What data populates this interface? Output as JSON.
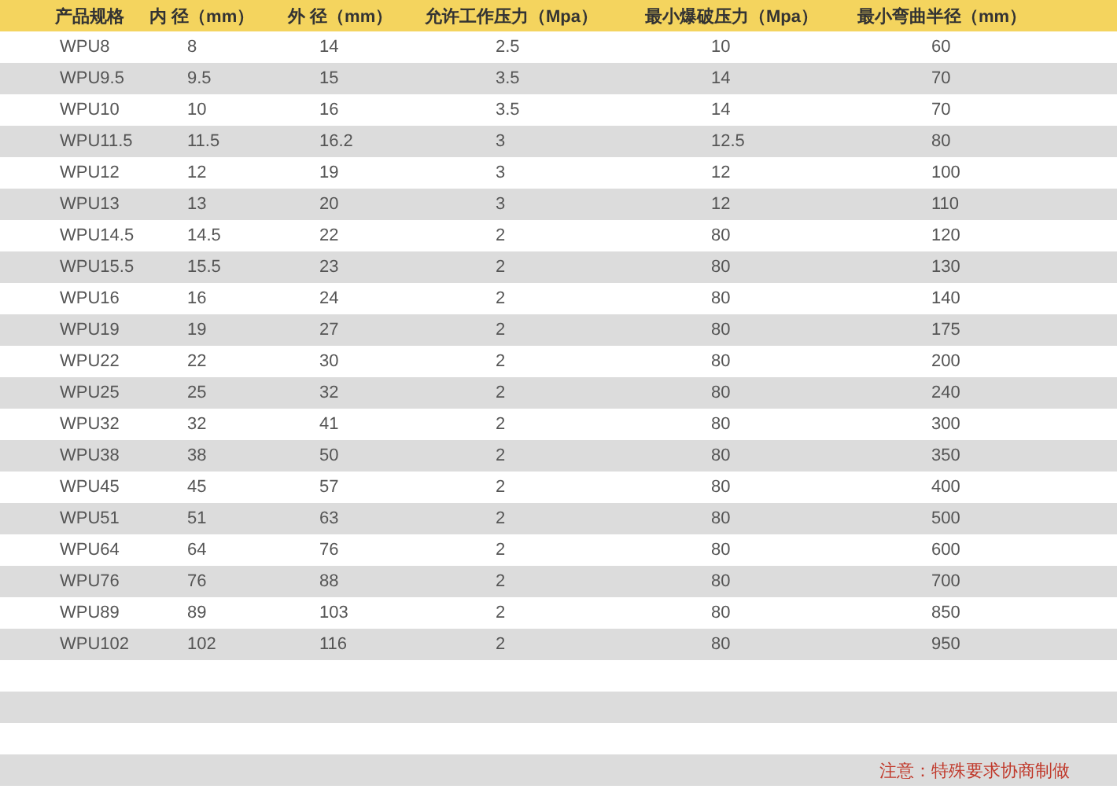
{
  "table": {
    "columns": [
      "产品规格",
      "内 径（mm）",
      "外 径（mm）",
      "允许工作压力（Mpa）",
      "最小爆破压力（Mpa）",
      "最小弯曲半径（mm）"
    ],
    "rows": [
      [
        "WPU8",
        "8",
        "14",
        "2.5",
        "10",
        "60"
      ],
      [
        "WPU9.5",
        "9.5",
        "15",
        "3.5",
        "14",
        "70"
      ],
      [
        "WPU10",
        "10",
        "16",
        "3.5",
        "14",
        "70"
      ],
      [
        "WPU11.5",
        "11.5",
        "16.2",
        "3",
        "12.5",
        "80"
      ],
      [
        "WPU12",
        "12",
        "19",
        "3",
        "12",
        "100"
      ],
      [
        "WPU13",
        "13",
        "20",
        "3",
        "12",
        "110"
      ],
      [
        "WPU14.5",
        "14.5",
        "22",
        "2",
        "80",
        "120"
      ],
      [
        "WPU15.5",
        "15.5",
        "23",
        "2",
        "80",
        "130"
      ],
      [
        "WPU16",
        "16",
        "24",
        "2",
        "80",
        "140"
      ],
      [
        "WPU19",
        "19",
        "27",
        "2",
        "80",
        "175"
      ],
      [
        "WPU22",
        "22",
        "30",
        "2",
        "80",
        "200"
      ],
      [
        "WPU25",
        "25",
        "32",
        "2",
        "80",
        "240"
      ],
      [
        "WPU32",
        "32",
        "41",
        "2",
        "80",
        "300"
      ],
      [
        "WPU38",
        "38",
        "50",
        "2",
        "80",
        "350"
      ],
      [
        "WPU45",
        "45",
        "57",
        "2",
        "80",
        "400"
      ],
      [
        "WPU51",
        "51",
        "63",
        "2",
        "80",
        "500"
      ],
      [
        "WPU64",
        "64",
        "76",
        "2",
        "80",
        "600"
      ],
      [
        "WPU76",
        "76",
        "88",
        "2",
        "80",
        "700"
      ],
      [
        "WPU89",
        "89",
        "103",
        "2",
        "80",
        "850"
      ],
      [
        "WPU102",
        "102",
        "116",
        "2",
        "80",
        "950"
      ]
    ]
  },
  "note": "注意：特殊要求协商制做"
}
